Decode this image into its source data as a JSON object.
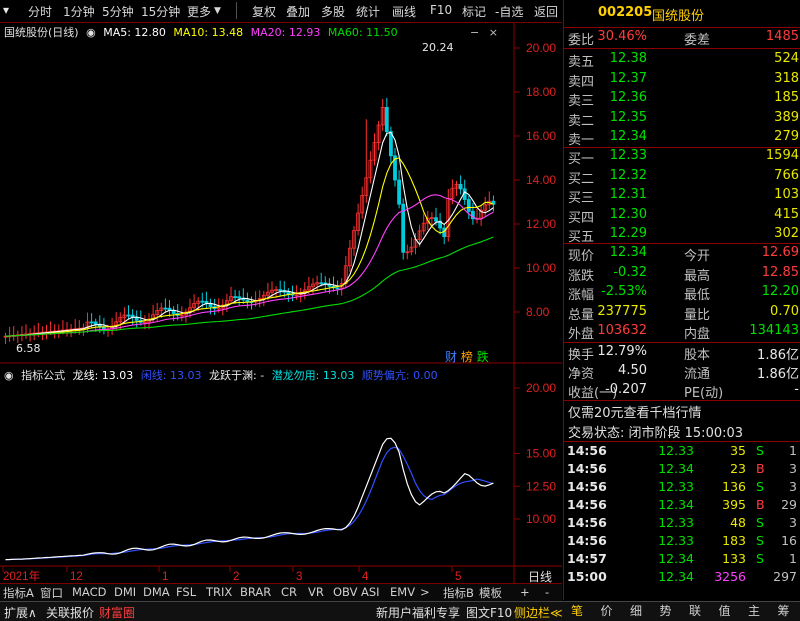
{
  "toolbar": {
    "items": [
      "分时",
      "1分钟",
      "5分钟",
      "15分钟",
      "更多",
      "复权",
      "叠加",
      "多股",
      "统计",
      "画线",
      "F10",
      "标记",
      "-自选",
      "返回"
    ]
  },
  "main_legend": {
    "name": "国统股份(日线)",
    "ma5": "MA5: 12.80",
    "ma10": "MA10: 13.48",
    "ma20": "MA20: 12.93",
    "ma60": "MA60: 11.50",
    "colors": {
      "ma5": "#ffffff",
      "ma10": "#ffff00",
      "ma20": "#ff40ff",
      "ma60": "#00dd00"
    }
  },
  "sub_legend": {
    "name": "指标公式",
    "l1": "龙线: 13.03",
    "l2": "闲线: 13.03",
    "l3": "龙跃于渊: -",
    "l4": "潜龙勿用: 13.03",
    "l5": "顺势偏亢: 0.00"
  },
  "annotations": {
    "high": "20.24",
    "low": "6.58"
  },
  "badges": [
    "财",
    "榜",
    "跌"
  ],
  "main_axis": [
    "20.00",
    "18.00",
    "16.00",
    "14.00",
    "12.00",
    "10.00",
    "8.00"
  ],
  "sub_axis": [
    "20.00",
    "15.00",
    "12.50",
    "10.00"
  ],
  "x_axis": [
    "2021年",
    "12",
    "1",
    "2",
    "3",
    "4",
    "5"
  ],
  "period_label": "日线",
  "indicator_tabs": [
    "指标A",
    "窗口",
    "MACD",
    "DMI",
    "DMA",
    "FSL",
    "TRIX",
    "BRAR",
    "CR",
    "VR",
    "OBV",
    "ASI",
    "EMV",
    ">",
    "指标B",
    "模板",
    "+",
    "-"
  ],
  "status_bar": {
    "expand": "扩展∧",
    "linked": "关联报价",
    "wealth": "财富圈",
    "promo": "新用户福利专享",
    "f10": "图文F10",
    "sidebar": "侧边栏≪"
  },
  "quote": {
    "code": "002205",
    "name": "国统股份",
    "weibi_label": "委比",
    "weibi": "30.46%",
    "weicha_label": "委差",
    "weicha": "1485",
    "sell": [
      {
        "label": "卖五",
        "price": "12.38",
        "vol": "524"
      },
      {
        "label": "卖四",
        "price": "12.37",
        "vol": "318"
      },
      {
        "label": "卖三",
        "price": "12.36",
        "vol": "185"
      },
      {
        "label": "卖二",
        "price": "12.35",
        "vol": "389"
      },
      {
        "label": "卖一",
        "price": "12.34",
        "vol": "279"
      }
    ],
    "buy": [
      {
        "label": "买一",
        "price": "12.33",
        "vol": "1594"
      },
      {
        "label": "买二",
        "price": "12.32",
        "vol": "766"
      },
      {
        "label": "买三",
        "price": "12.31",
        "vol": "103"
      },
      {
        "label": "买四",
        "price": "12.30",
        "vol": "415"
      },
      {
        "label": "买五",
        "price": "12.29",
        "vol": "302"
      }
    ],
    "stats": [
      {
        "l1": "现价",
        "v1": "12.34",
        "l2": "今开",
        "v2": "12.69",
        "c1": "green",
        "c2": "red"
      },
      {
        "l1": "涨跌",
        "v1": "-0.32",
        "l2": "最高",
        "v2": "12.85",
        "c1": "green",
        "c2": "red"
      },
      {
        "l1": "涨幅",
        "v1": "-2.53%",
        "l2": "最低",
        "v2": "12.20",
        "c1": "green",
        "c2": "green"
      },
      {
        "l1": "总量",
        "v1": "237775",
        "l2": "量比",
        "v2": "0.70",
        "c1": "yellow",
        "c2": "yellow"
      },
      {
        "l1": "外盘",
        "v1": "103632",
        "l2": "内盘",
        "v2": "134143",
        "c1": "red",
        "c2": "green"
      }
    ],
    "stats2": [
      {
        "l1": "换手",
        "v1": "12.79%",
        "l2": "股本",
        "v2": "1.86亿"
      },
      {
        "l1": "净资",
        "v1": "4.50",
        "l2": "流通",
        "v2": "1.86亿"
      },
      {
        "l1": "收益(一)",
        "v1": "-0.207",
        "l2": "PE(动)",
        "v2": "-"
      }
    ],
    "promo": "仅需20元查看千档行情",
    "trade_state": "交易状态: 闭市阶段 15:00:03",
    "ticks": [
      {
        "t": "14:56",
        "p": "12.33",
        "v": "35",
        "d": "S",
        "n": "1"
      },
      {
        "t": "14:56",
        "p": "12.34",
        "v": "23",
        "d": "B",
        "n": "3"
      },
      {
        "t": "14:56",
        "p": "12.33",
        "v": "136",
        "d": "S",
        "n": "3"
      },
      {
        "t": "14:56",
        "p": "12.34",
        "v": "395",
        "d": "B",
        "n": "29"
      },
      {
        "t": "14:56",
        "p": "12.33",
        "v": "48",
        "d": "S",
        "n": "3"
      },
      {
        "t": "14:56",
        "p": "12.33",
        "v": "183",
        "d": "S",
        "n": "16"
      },
      {
        "t": "14:57",
        "p": "12.34",
        "v": "133",
        "d": "S",
        "n": "1"
      },
      {
        "t": "15:00",
        "p": "12.34",
        "v": "3256",
        "d": "",
        "n": "297"
      }
    ],
    "tabs": [
      "笔",
      "价",
      "细",
      "势",
      "联",
      "值",
      "主",
      "筹"
    ]
  }
}
